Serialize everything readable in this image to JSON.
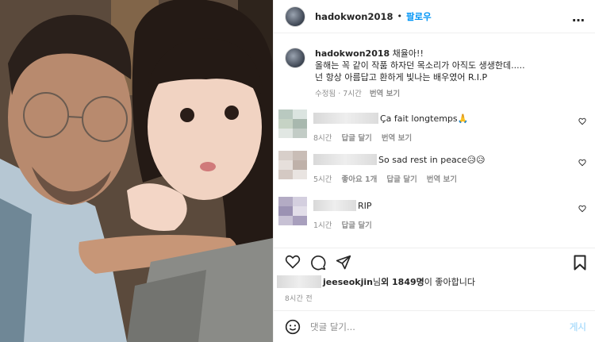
{
  "header": {
    "username": "hadokwon2018",
    "separator": "•",
    "follow_label": "팔로우",
    "more_icon": "…"
  },
  "caption": {
    "username": "hadokwon2018",
    "line1": "채율아!!",
    "line2": "올해는 꼭 같이 작품 하자던 목소리가 아직도 생생한데.....",
    "line3": "넌 항상 아름답고 환하게 빛나는 배우였어 R.I.P",
    "edited": "수정됨 · 7시간",
    "translate": "번역 보기"
  },
  "comments": [
    {
      "text": "Ça fait longtemps ",
      "emoji": "🙏",
      "time": "8시간",
      "reply": "답글 달기",
      "translate": "번역 보기",
      "likes": ""
    },
    {
      "text": "So sad rest in peace",
      "emoji": "😥😥",
      "time": "5시간",
      "likes": "좋아요 1개",
      "reply": "답글 달기",
      "translate": "번역 보기"
    },
    {
      "text": "RIP",
      "emoji": "",
      "time": "1시간",
      "reply": "답글 달기",
      "translate": "",
      "likes": ""
    }
  ],
  "likes": {
    "liker": "jeeseokjin",
    "suffix1": "님 ",
    "others": "외 1849명",
    "suffix2": "이 좋아합니다"
  },
  "timestamp": "8시간 전",
  "add_comment": {
    "placeholder": "댓글 달기...",
    "post_label": "게시"
  },
  "colors": {
    "accent": "#0095f6",
    "muted": "#8e8e8e",
    "post_disabled": "#b2dffc"
  }
}
